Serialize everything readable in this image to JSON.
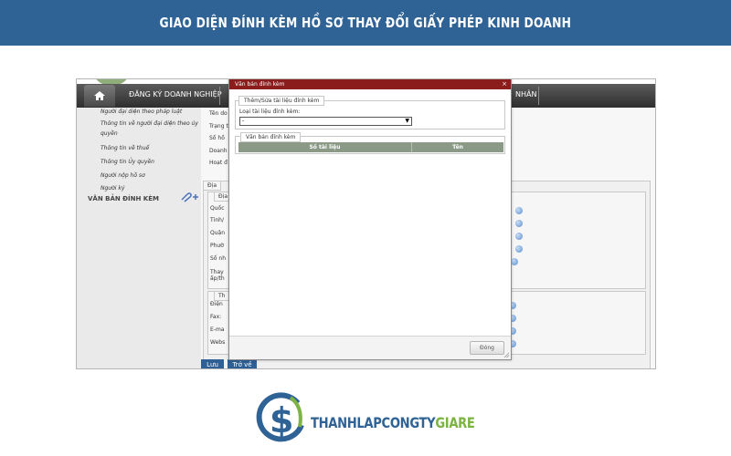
{
  "banner": {
    "title": "GIAO DIỆN ĐÍNH KÈM HỒ SƠ THAY ĐỔI GIẤY PHÉP KINH DOANH"
  },
  "navbar": {
    "items": [
      "ĐĂNG KÝ DOANH NGHIỆP",
      "NHÂN"
    ]
  },
  "sidebar": {
    "links": [
      "Người đại diện theo pháp luật",
      "Thông tin về người đại diện theo ủy quyền",
      "Thông tin về thuế",
      "Thông tin Ủy quyền",
      "Người nộp hồ sơ",
      "Người ký"
    ],
    "section_heading": "VĂN BẢN ĐÍNH KÈM"
  },
  "form": {
    "labels": [
      "Tên do",
      "Trạng t",
      "Số hồ",
      "Doanh",
      "Hoạt đ"
    ],
    "address_tab": "Địa",
    "address_subtab": "Địa",
    "address_labels": [
      "Quốc",
      "Tỉnh/",
      "Quận",
      "Phườ",
      "Số nh",
      "Thay",
      "ấp/th"
    ],
    "contact_subtab": "Th",
    "contact_labels": [
      "Điện",
      "Fax:",
      "E-ma",
      "Webs"
    ]
  },
  "buttons": {
    "save": "Lưu",
    "back": "Trở về"
  },
  "modal": {
    "title": "Văn bản đính kèm",
    "close": "×",
    "edit_legend": "Thêm/Sửa tài liệu đính kèm",
    "type_label": "Loại tài liệu đính kèm:",
    "type_value": "-",
    "list_legend": "Văn bản đính kèm",
    "columns": [
      "Số tài liệu",
      "Tên"
    ],
    "close_button": "Đóng"
  },
  "brand": {
    "part1": "THANHLAPCONGTY",
    "part2": "GIARE"
  },
  "colors": {
    "banner": "#2f6396",
    "modal_title": "#8b1d1d",
    "grid_header": "#8a9a86",
    "brand_green": "#7cb342"
  }
}
